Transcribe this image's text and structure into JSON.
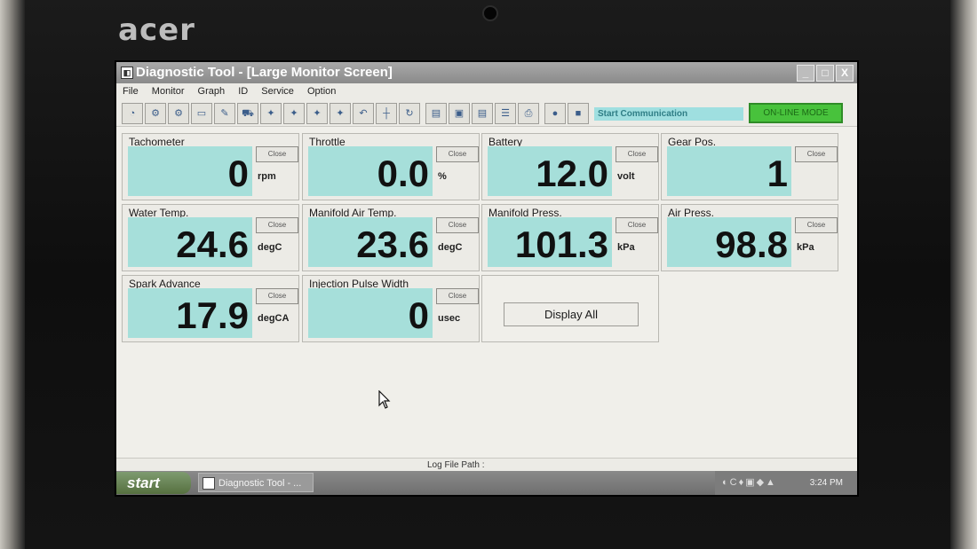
{
  "device": {
    "brand": "acer"
  },
  "window": {
    "title": "Diagnostic Tool - [Large Monitor Screen]",
    "controls": [
      "_",
      "□",
      "X"
    ]
  },
  "menu": [
    "File",
    "Monitor",
    "Graph",
    "ID",
    "Service",
    "Option"
  ],
  "toolbar": {
    "status_text": "Start Communication",
    "mode_button": "ON-LINE MODE"
  },
  "panels": [
    {
      "title": "Tachometer",
      "value": "0",
      "unit": "rpm",
      "close": "Close"
    },
    {
      "title": "Throttle",
      "value": "0.0",
      "unit": "%",
      "close": "Close"
    },
    {
      "title": "Battery",
      "value": "12.0",
      "unit": "volt",
      "close": "Close"
    },
    {
      "title": "Gear Pos.",
      "value": "1",
      "unit": "",
      "close": "Close"
    },
    {
      "title": "Water Temp.",
      "value": "24.6",
      "unit": "degC",
      "close": "Close"
    },
    {
      "title": "Manifold Air Temp.",
      "value": "23.6",
      "unit": "degC",
      "close": "Close"
    },
    {
      "title": "Manifold Press.",
      "value": "101.3",
      "unit": "kPa",
      "close": "Close"
    },
    {
      "title": "Air Press.",
      "value": "98.8",
      "unit": "kPa",
      "close": "Close"
    },
    {
      "title": "Spark Advance",
      "value": "17.9",
      "unit": "degCA",
      "close": "Close"
    },
    {
      "title": "Injection Pulse Width",
      "value": "0",
      "unit": "usec",
      "close": "Close"
    }
  ],
  "display_all_button": "Display All",
  "status_bar": {
    "log_path_label": "Log File Path :"
  },
  "taskbar": {
    "start_label": "start",
    "task_item": "Diagnostic Tool - ...",
    "clock": "3:24 PM"
  }
}
